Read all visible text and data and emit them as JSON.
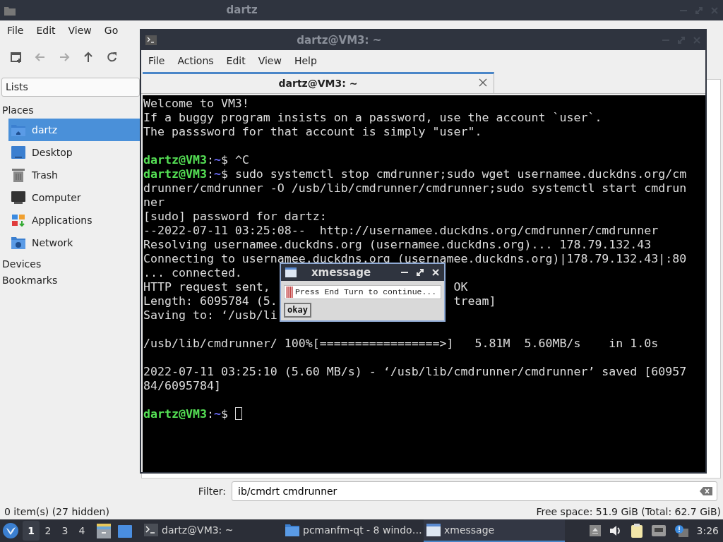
{
  "file_manager": {
    "title": "dartz",
    "menu": [
      "File",
      "Edit",
      "View",
      "Go"
    ],
    "toolbar": [
      {
        "kind": "new-tab",
        "disabled": false
      },
      {
        "kind": "back",
        "disabled": true
      },
      {
        "kind": "forward",
        "disabled": true
      },
      {
        "kind": "up",
        "disabled": false
      },
      {
        "kind": "reload",
        "disabled": false
      }
    ],
    "side_pane": {
      "mode": "Lists",
      "sections": [
        {
          "title": "Places",
          "items": [
            {
              "label": "dartz",
              "selected": true
            },
            {
              "label": "Desktop",
              "selected": false
            },
            {
              "label": "Trash",
              "selected": false
            },
            {
              "label": "Computer",
              "selected": false
            },
            {
              "label": "Applications",
              "selected": false
            },
            {
              "label": "Network",
              "selected": false
            }
          ]
        },
        {
          "title": "Devices"
        },
        {
          "title": "Bookmarks"
        }
      ]
    },
    "filter": {
      "label": "Filter:",
      "value": "ib/cmdrt cmdrunner"
    },
    "status_bar": {
      "items": "0 item(s) (27 hidden)",
      "free_space": "Free space: 51.9 GiB (Total: 62.7 GiB)"
    }
  },
  "terminal": {
    "title": "dartz@VM3: ~",
    "menu": [
      "File",
      "Actions",
      "Edit",
      "View",
      "Help"
    ],
    "tabs": [
      {
        "label": "dartz@VM3: ~",
        "selected": true
      }
    ],
    "lines": [
      {
        "kind": "output",
        "text": "Welcome to VM3!"
      },
      {
        "kind": "output",
        "text": "If a buggy program insists on a password, use the account `user`."
      },
      {
        "kind": "output",
        "text": "The passsword for that account is simply \"user\"."
      },
      {
        "kind": "blank"
      },
      {
        "kind": "prompt",
        "user": "dartz@VM3",
        "sep": ":",
        "path": "~",
        "symbol": "$",
        "command": " ^C"
      },
      {
        "kind": "prompt",
        "user": "dartz@VM3",
        "sep": ":",
        "path": "~",
        "symbol": "$",
        "command": " sudo systemctl stop cmdrunner;sudo wget usernamee.duckdns.org/cm"
      },
      {
        "kind": "output",
        "text": "drunner/cmdrunner -O /usb/lib/cmdrunner/cmdrunner;sudo systemctl start cmdrun"
      },
      {
        "kind": "output",
        "text": "ner"
      },
      {
        "kind": "output",
        "text": "[sudo] password for dartz:"
      },
      {
        "kind": "output",
        "text": "--2022-07-11 03:25:08--  http://usernamee.duckdns.org/cmdrunner/cmdrunner"
      },
      {
        "kind": "output",
        "text": "Resolving usernamee.duckdns.org (usernamee.duckdns.org)... 178.79.132.43"
      },
      {
        "kind": "output",
        "text": "Connecting to usernamee.duckdns.org (usernamee.duckdns.org)|178.79.132.43|:80"
      },
      {
        "kind": "output",
        "text": "... connected."
      },
      {
        "kind": "occluded",
        "segments": [
          "HTTP request sent, ",
          "OK"
        ]
      },
      {
        "kind": "occluded",
        "segments": [
          "Length: 6095784 (5.",
          "tream]"
        ]
      },
      {
        "kind": "occluded",
        "segments": [
          "Saving to: ‘/usb/li"
        ]
      },
      {
        "kind": "blank"
      },
      {
        "kind": "output",
        "text": "/usb/lib/cmdrunner/ 100%[=================>]   5.81M  5.60MB/s    in 1.0s"
      },
      {
        "kind": "blank"
      },
      {
        "kind": "output",
        "text": "2022-07-11 03:25:10 (5.60 MB/s) - ‘/usb/lib/cmdrunner/cmdrunner’ saved [60957"
      },
      {
        "kind": "output",
        "text": "84/6095784]"
      },
      {
        "kind": "blank"
      },
      {
        "kind": "prompt",
        "user": "dartz@VM3",
        "sep": ":",
        "path": "~",
        "symbol": "$",
        "cursor": true
      }
    ]
  },
  "xmessage": {
    "title": "xmessage",
    "message": "Press End Turn to continue...",
    "button": "okay"
  },
  "taskbar": {
    "desktops": [
      {
        "label": "1",
        "selected": true
      },
      {
        "label": "2",
        "selected": false
      },
      {
        "label": "3",
        "selected": false
      },
      {
        "label": "4",
        "selected": false
      }
    ],
    "tasks": [
      {
        "label": "dartz@VM3: ~",
        "selected": false
      },
      {
        "label": "pcmanfm-qt - 8 windo…",
        "selected": false
      },
      {
        "label": "xmessage",
        "selected": true
      }
    ],
    "clock": "3:26"
  }
}
